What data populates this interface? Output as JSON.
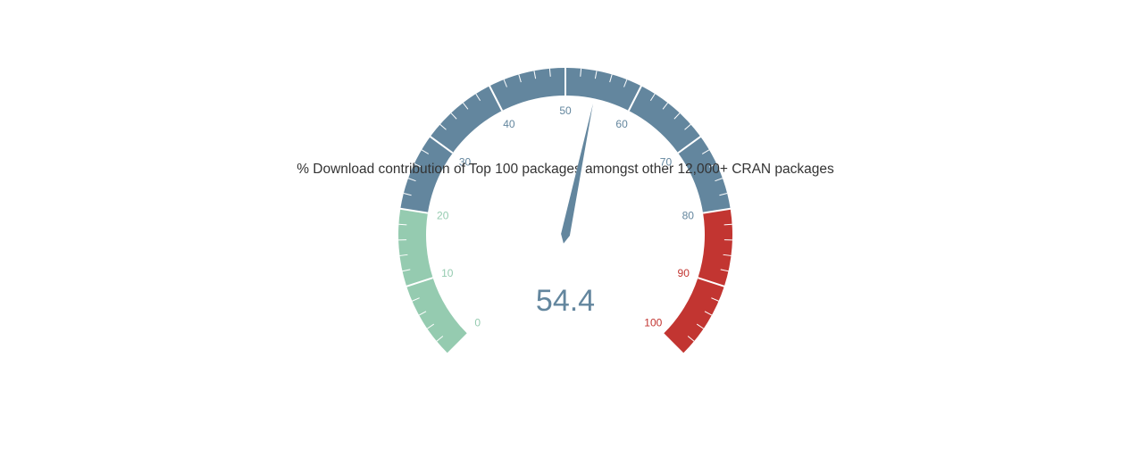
{
  "chart_data": {
    "type": "gauge",
    "title": "% Download contribution of Top 100 packages amongst other 12,000+ CRAN packages",
    "value": 54.4,
    "value_label": "54.4",
    "min": 0,
    "max": 100,
    "ticks": [
      {
        "value": 0,
        "label": "0"
      },
      {
        "value": 10,
        "label": "10"
      },
      {
        "value": 20,
        "label": "20"
      },
      {
        "value": 30,
        "label": "30"
      },
      {
        "value": 40,
        "label": "40"
      },
      {
        "value": 50,
        "label": "50"
      },
      {
        "value": 60,
        "label": "60"
      },
      {
        "value": 70,
        "label": "70"
      },
      {
        "value": 80,
        "label": "80"
      },
      {
        "value": 90,
        "label": "90"
      },
      {
        "value": 100,
        "label": "100"
      }
    ],
    "bands": [
      {
        "from": 0,
        "to": 20,
        "color": "#95cbb0"
      },
      {
        "from": 20,
        "to": 80,
        "color": "#63869e"
      },
      {
        "from": 80,
        "to": 100,
        "color": "#c23531"
      }
    ],
    "pointer_color": "#63869e",
    "value_color": "#63869e"
  }
}
